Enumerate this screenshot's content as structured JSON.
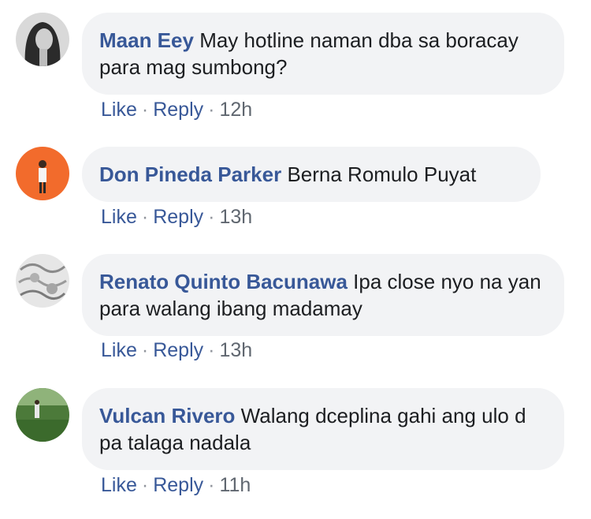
{
  "comments": [
    {
      "author": "Maan Eey",
      "text": "May hotline naman dba sa boracay para mag sumbong?",
      "like_label": "Like",
      "reply_label": "Reply",
      "time": "12h",
      "avatar_icon": "profile-photo-woman-dark-hair"
    },
    {
      "author": "Don Pineda Parker",
      "text": "Berna Romulo Puyat",
      "like_label": "Like",
      "reply_label": "Reply",
      "time": "13h",
      "avatar_icon": "profile-photo-person-orange-background"
    },
    {
      "author": "Renato Quinto Bacunawa",
      "text": "Ipa close nyo na yan para walang ibang madamay",
      "like_label": "Like",
      "reply_label": "Reply",
      "time": "13h",
      "avatar_icon": "profile-photo-grey-pattern"
    },
    {
      "author": "Vulcan Rivero",
      "text": "Walang dceplina gahi ang ulo d pa talaga nadala",
      "like_label": "Like",
      "reply_label": "Reply",
      "time": "11h",
      "avatar_icon": "profile-photo-green-field"
    }
  ],
  "colors": {
    "author": "#385898",
    "bubble": "#f2f3f5",
    "meta": "#606770"
  }
}
